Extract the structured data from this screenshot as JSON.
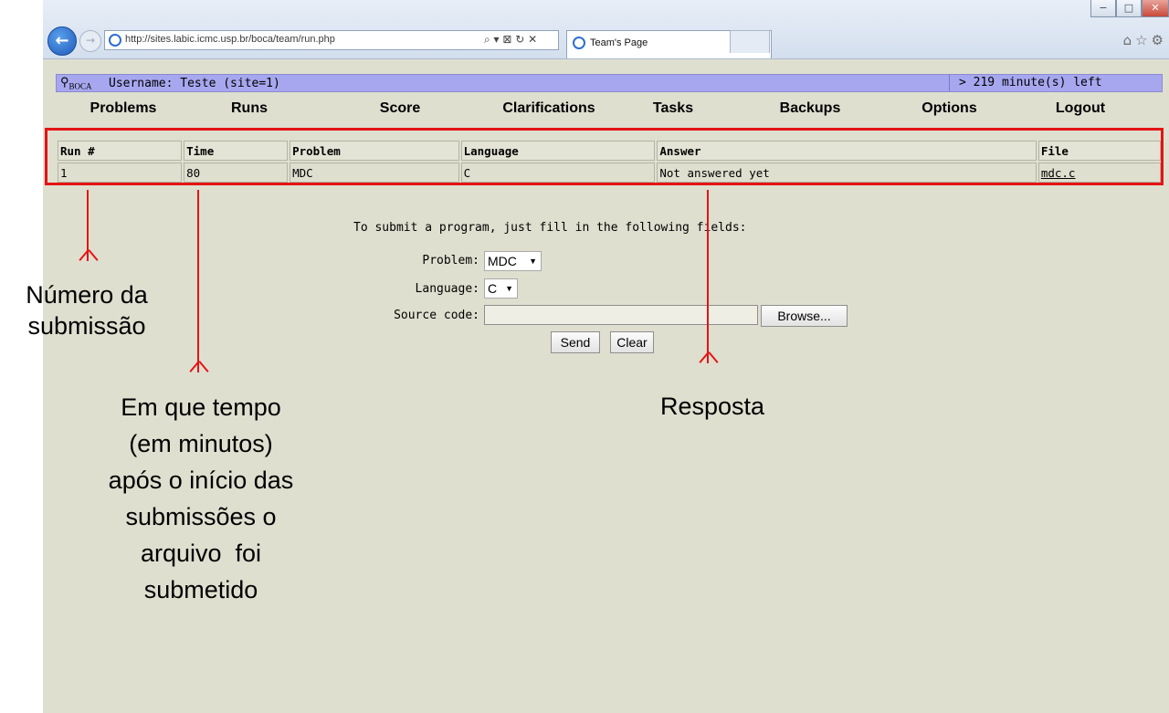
{
  "browser": {
    "url": "http://sites.labic.icmc.usp.br/boca/team/run.php",
    "address_tools": "⌕ ▾ ⊠ ↻ ✕",
    "tab_title": "Team's Page",
    "tab_close": "×",
    "right_icons": "⌂☆⚙",
    "win_minimize": "−",
    "win_restore": "□",
    "win_close": "✕"
  },
  "header": {
    "logo": "BOCA",
    "user_info": "Username: Teste (site=1)",
    "time_left": "> 219 minute(s) left"
  },
  "menu": [
    "Problems",
    "Runs",
    "Score",
    "Clarifications",
    "Tasks",
    "Backups",
    "Options",
    "Logout"
  ],
  "runs_table": {
    "columns": [
      "Run #",
      "Time",
      "Problem",
      "Language",
      "Answer",
      "File"
    ],
    "rows": [
      [
        "1",
        "80",
        "MDC",
        "C",
        "Not answered yet",
        "mdc.c"
      ]
    ]
  },
  "submit_form": {
    "instruction": "To submit a program, just fill in the following fields:",
    "problem_label": "Problem:",
    "problem_value": "MDC",
    "language_label": "Language:",
    "language_value": "C",
    "source_label": "Source code:",
    "browse_label": "Browse...",
    "send_label": "Send",
    "clear_label": "Clear"
  },
  "annotations": {
    "run_number": [
      "Número da",
      "submissão"
    ],
    "time": [
      "Em que tempo",
      "(em minutos)",
      "após o início das",
      "submissões o",
      "arquivo  foi",
      "submetido"
    ],
    "answer": [
      "Resposta"
    ]
  },
  "colors": {
    "page_bg": "#dfdfd0",
    "header_bar": "#a7a7f0",
    "highlight": "#e41414"
  }
}
